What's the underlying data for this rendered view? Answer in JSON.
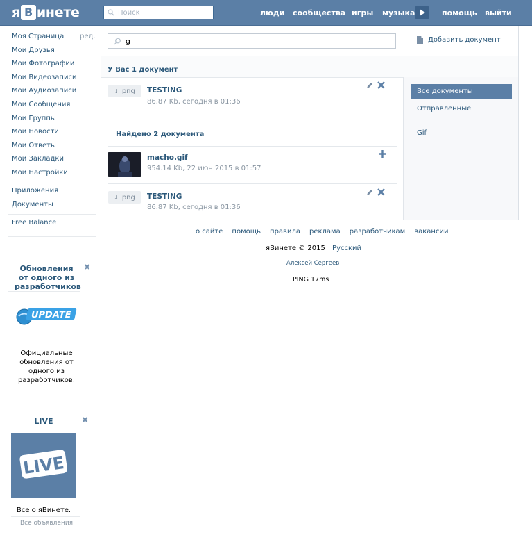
{
  "header": {
    "logo_left": "я",
    "logo_box": "В",
    "logo_right": "инете",
    "search_placeholder": "Поиск",
    "nav": [
      "люди",
      "сообщества",
      "игры",
      "музыка",
      "помощь",
      "выйти"
    ]
  },
  "sidebar": {
    "edit_label": "ред.",
    "items": [
      "Моя Страница",
      "Мои Друзья",
      "Мои Фотографии",
      "Мои Видеозаписи",
      "Мои Аудиозаписи",
      "Мои Сообщения",
      "Мои Группы",
      "Мои Новости",
      "Мои Ответы",
      "Мои Закладки",
      "Мои Настройки"
    ],
    "items2": [
      "Приложения",
      "Документы"
    ],
    "items3": [
      "Free Balance"
    ]
  },
  "ads": [
    {
      "title": "Обновления от одного из разработчиков",
      "image_text": "UPDATE",
      "text": "Официальные обновления от одного из разработчиков."
    },
    {
      "title": "LIVE",
      "image_text": "LIVE",
      "text": "Все о яВинете.",
      "footer": "Все объявления"
    }
  ],
  "docs": {
    "search_value": "g",
    "add_document": "Добавить документ",
    "my_section_title": "У Вас 1 документ",
    "found_section_title": "Найдено 2 документа",
    "my_docs": [
      {
        "badge": "png",
        "name": "TESTING",
        "meta": "86.87 Kb, сегодня в 01:36"
      }
    ],
    "found_docs": [
      {
        "badge": "",
        "name": "macho.gif",
        "meta": "954.14 Kb, 22 июн 2015 в 01:57"
      },
      {
        "badge": "png",
        "name": "TESTING",
        "meta": "86.87 Kb, сегодня в 01:36"
      }
    ]
  },
  "filters": {
    "items": [
      "Все документы",
      "Отправленные",
      "Gif"
    ]
  },
  "footer": {
    "links": [
      "о сайте",
      "помощь",
      "правила",
      "реклама",
      "разработчикам",
      "вакансии"
    ],
    "copyright": "яВинете © 2015",
    "language": "Русский",
    "author": "Алексей Сергеев",
    "ping": "PING 17ms"
  }
}
